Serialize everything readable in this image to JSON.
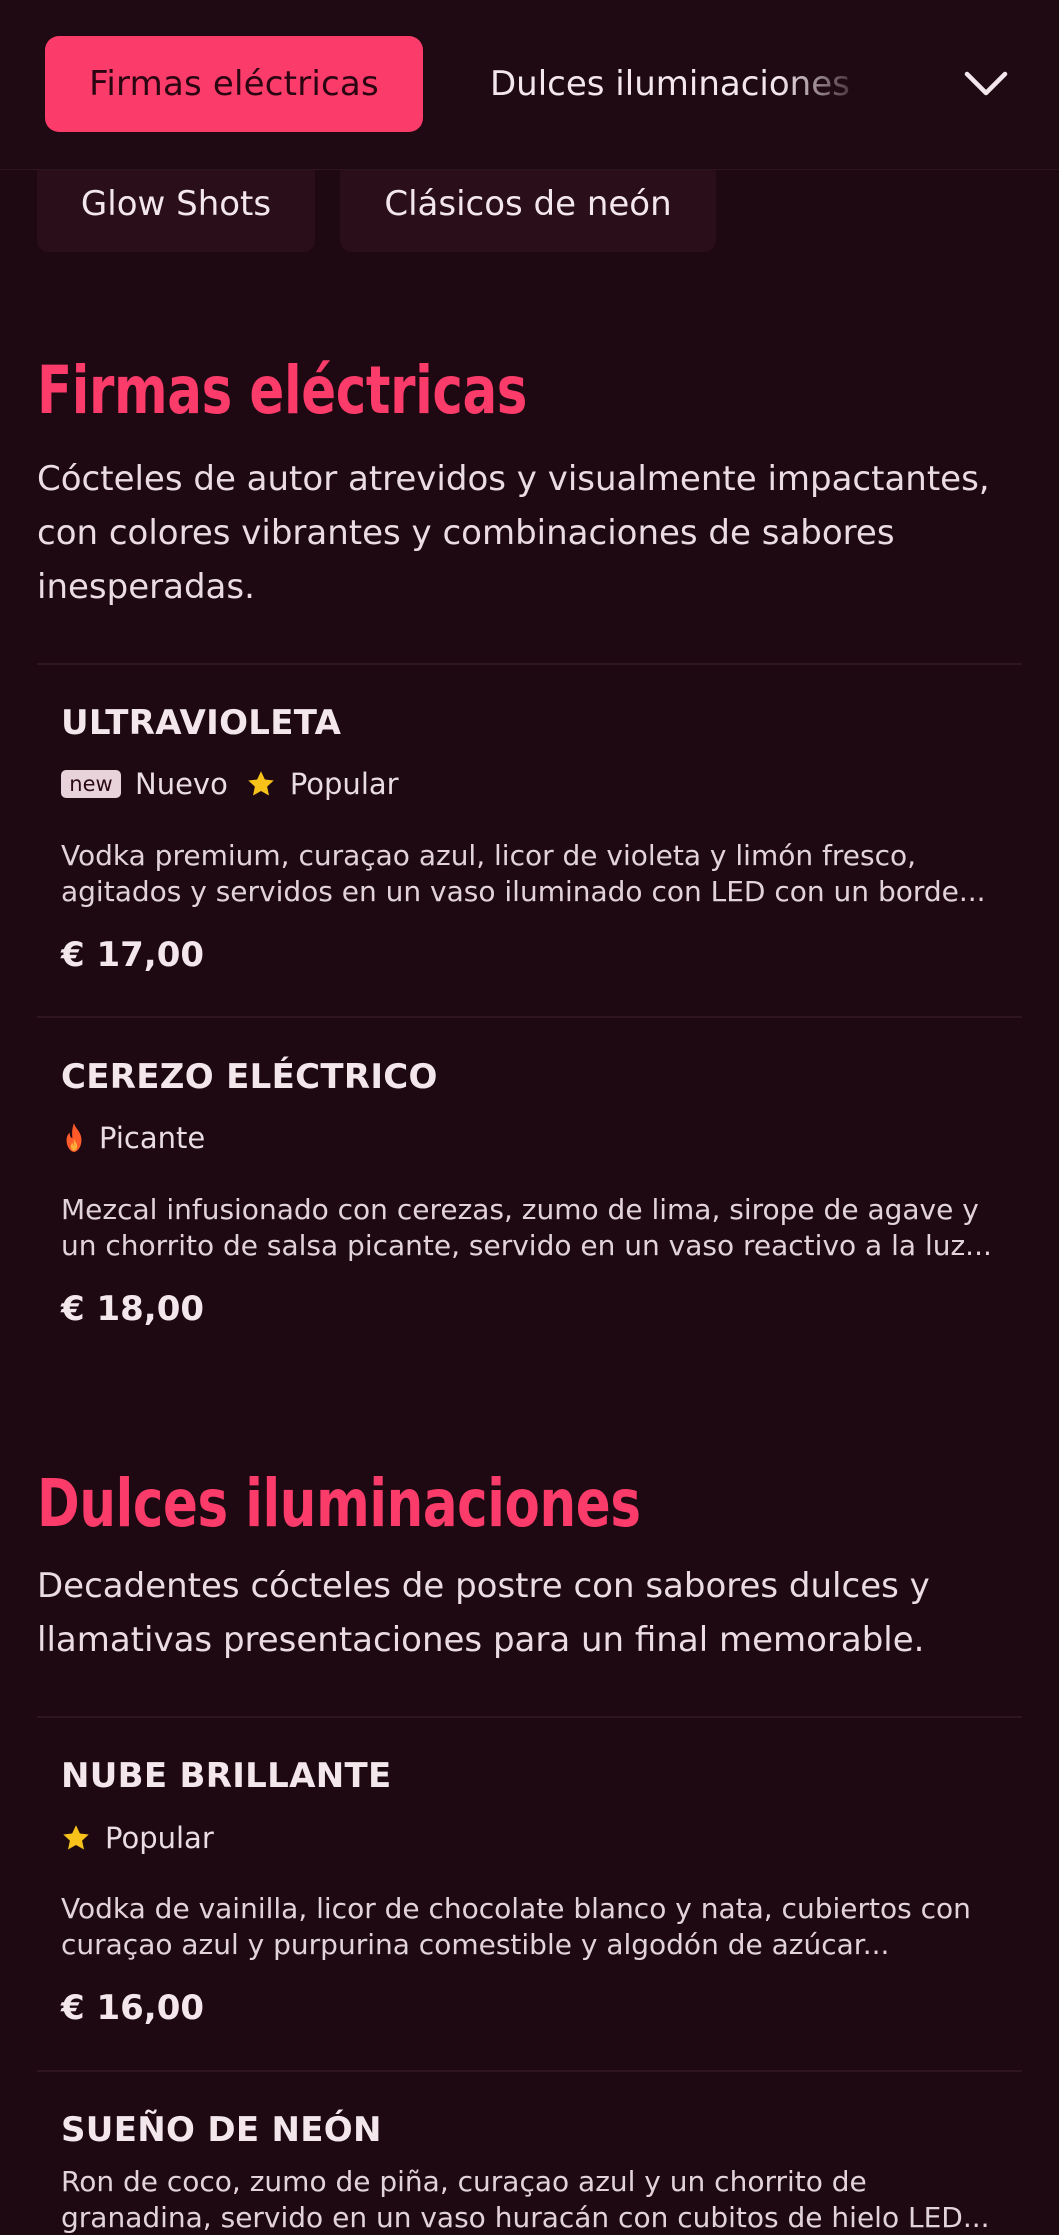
{
  "category_nav": {
    "active_tab": "Firmas eléctricas",
    "next_tab": "Dulces iluminaciones",
    "expand_icon": "chevron-down-icon",
    "chips": [
      "Glow Shots",
      "Clásicos de neón"
    ]
  },
  "colors": {
    "background": "#1e0912",
    "accent": "#fb3b6a",
    "star": "#f7c21a",
    "flame": "#ff5a2a"
  },
  "sections": [
    {
      "title": "Firmas eléctricas",
      "description": "Cócteles de autor atrevidos y visualmente impactantes, con colores vibrantes y combinaciones de sabores inesperadas.",
      "items": [
        {
          "name": "ULTRAVIOLETA",
          "badge": "new",
          "tags": [
            "Nuevo",
            "Popular"
          ],
          "description_line1": "Vodka premium, curaçao azul, licor de violeta y limón fresco,",
          "description_line2": "agitados y servidos en un vaso iluminado con LED con un borde...",
          "price": "€ 17,00"
        },
        {
          "name": "CEREZO ELÉCTRICO",
          "tags": [
            "Picante"
          ],
          "description_line1": "Mezcal infusionado con cerezas, zumo de lima, sirope de agave y",
          "description_line2": "un chorrito de salsa picante, servido en un vaso reactivo a la luz...",
          "price": "€ 18,00"
        }
      ]
    },
    {
      "title": "Dulces iluminaciones",
      "description": "Decadentes cócteles de postre con sabores dulces y llamativas presentaciones para un final memorable.",
      "items": [
        {
          "name": "NUBE BRILLANTE",
          "tags": [
            "Popular"
          ],
          "description_line1": "Vodka de vainilla, licor de chocolate blanco y nata, cubiertos con",
          "description_line2": "curaçao azul y purpurina comestible y algodón de azúcar...",
          "price": "€ 16,00"
        },
        {
          "name": "SUEÑO DE NEÓN",
          "description_line1": "Ron de coco, zumo de piña, curaçao azul y un chorrito de",
          "description_line2": "granadina, servido en un vaso huracán con cubitos de hielo LED..."
        }
      ]
    }
  ]
}
